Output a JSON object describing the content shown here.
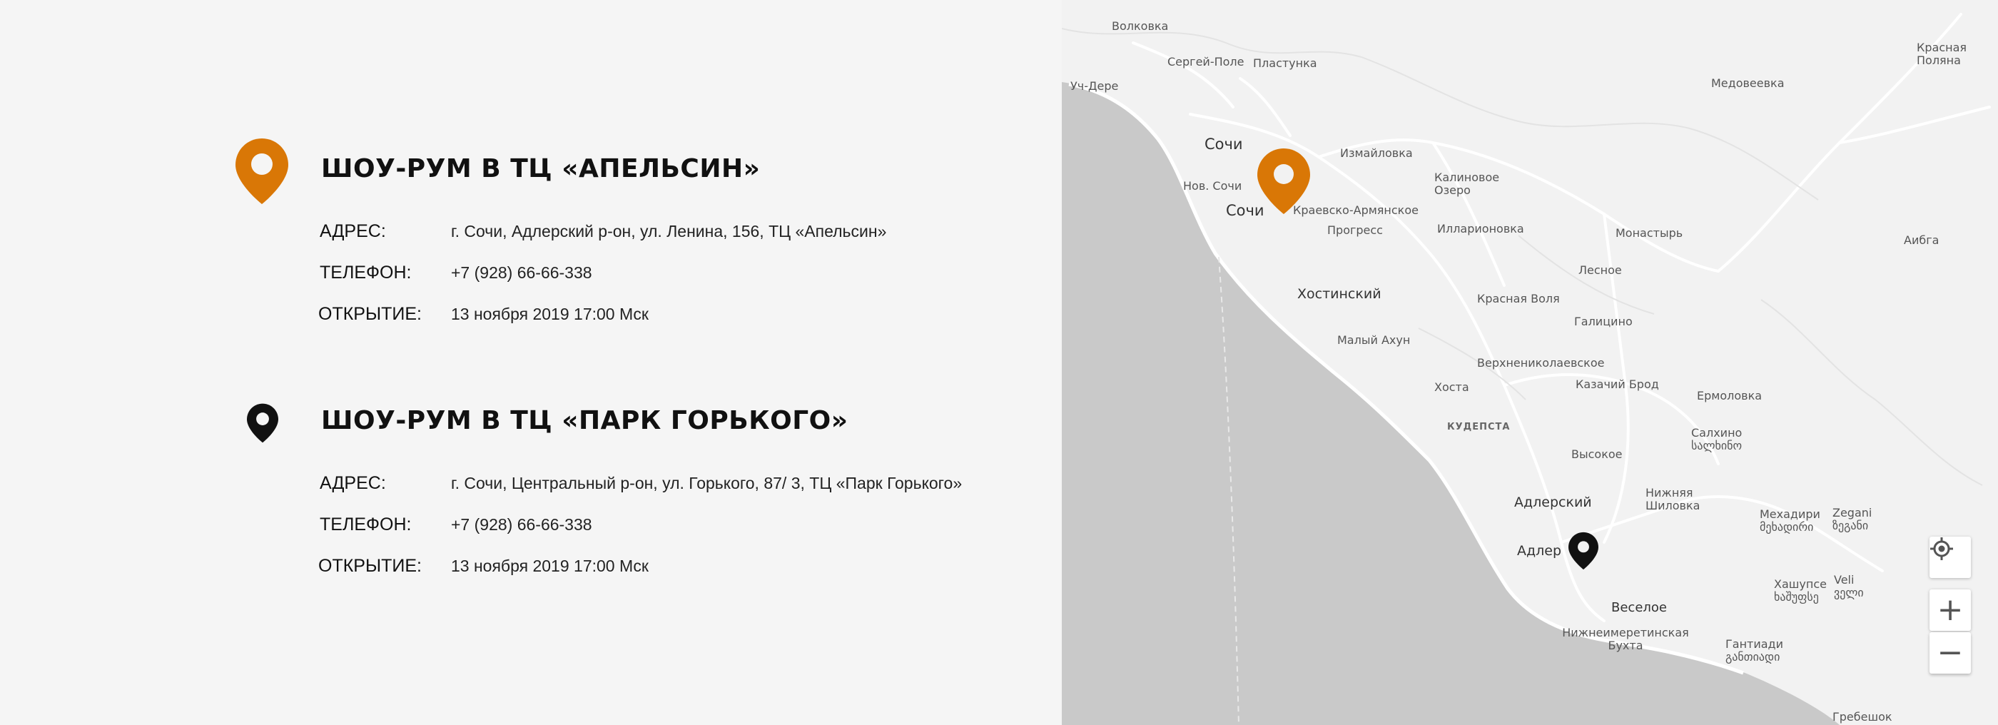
{
  "stores": [
    {
      "title": "ШОУ-РУМ В ТЦ «АПЕЛЬСИН»",
      "pin_color": "#d97706",
      "address_label": "АДРЕС:",
      "address": "г. Сочи, Адлерский р-он, ул.  Ленина, 156, ТЦ «Апельсин»",
      "phone_label": "ТЕЛЕФОН:",
      "phone": "+7 (928) 66-66-338",
      "opening_label": "ОТКРЫТИЕ:",
      "opening": "13 ноября 2019  17:00 Мск"
    },
    {
      "title": "ШОУ-РУМ В ТЦ «ПАРК ГОРЬКОГО»",
      "pin_color": "#111111",
      "address_label": "АДРЕС:",
      "address": "г. Сочи, Центральный р-он, ул.  Горького, 87/ 3, ТЦ «Парк Горького»",
      "phone_label": "ТЕЛЕФОН:",
      "phone": "+7 (928) 66-66-338",
      "opening_label": "ОТКРЫТИЕ:",
      "opening": "13 ноября 2019  17:00 Мск"
    }
  ],
  "map": {
    "colors": {
      "land": "#f2f2f2",
      "sea": "#c9c9c9",
      "road": "#ffffff"
    },
    "places": [
      "Волковка",
      "Сергей-Поле",
      "Пластунка",
      "Уч-Дере",
      "Сочи",
      "Нов. Сочи",
      "Сочи",
      "Измайловка",
      "Калиновое Озеро",
      "Краевско-Армянское",
      "Прогресс",
      "Илларионовка",
      "Хостинский",
      "Малый Ахун",
      "Красная Воля",
      "Лесное",
      "Галицино",
      "Верхнениколаевское",
      "Хоста",
      "Казачий Брод",
      "КУДЕПСТА",
      "Высокое",
      "Ермоловка",
      "Салхино სალხინო",
      "Адлерский",
      "Адлер",
      "Нижняя Шиловка",
      "Веселое",
      "Мехадири მეხადირი",
      "Zegani ზეგანი",
      "Хашупсе ხაშუფსე",
      "Veli ველი",
      "Нижнеимеретинская Бухта",
      "Гантиади განთიადი",
      "Гребешок",
      "Монастырь",
      "Медовеевка",
      "Красная Поляна",
      "Аибга"
    ],
    "controls": {
      "locate": "locate-icon",
      "zoom_in": "+",
      "zoom_out": "−"
    }
  }
}
